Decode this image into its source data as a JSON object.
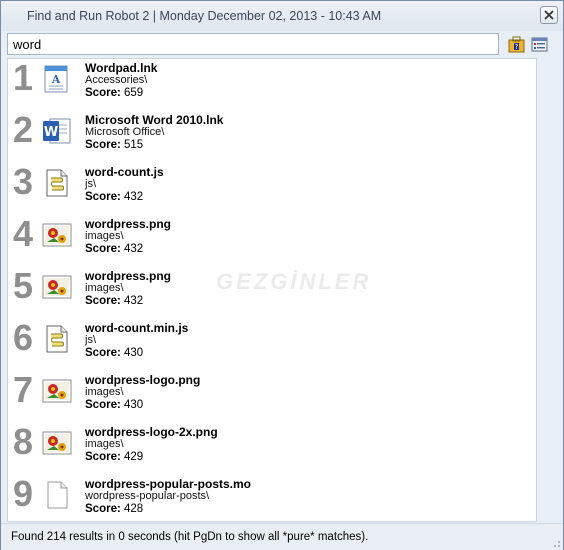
{
  "window": {
    "title": "Find and Run Robot 2 | Monday December 02, 2013  -  10:43 AM"
  },
  "search": {
    "value": "word"
  },
  "score_label": "Score:",
  "watermark": "GEZGİNLER",
  "results": [
    {
      "num": "1",
      "name": "Wordpad.lnk",
      "path": "Accessories\\",
      "score": "659",
      "icon": "wordpad-icon"
    },
    {
      "num": "2",
      "name": "Microsoft Word 2010.lnk",
      "path": "Microsoft Office\\",
      "score": "515",
      "icon": "word-icon"
    },
    {
      "num": "3",
      "name": "word-count.js",
      "path": "js\\",
      "score": "432",
      "icon": "script-icon"
    },
    {
      "num": "4",
      "name": "wordpress.png",
      "path": "images\\",
      "score": "432",
      "icon": "image-icon"
    },
    {
      "num": "5",
      "name": "wordpress.png",
      "path": "images\\",
      "score": "432",
      "icon": "image-icon"
    },
    {
      "num": "6",
      "name": "word-count.min.js",
      "path": "js\\",
      "score": "430",
      "icon": "script-icon"
    },
    {
      "num": "7",
      "name": "wordpress-logo.png",
      "path": "images\\",
      "score": "430",
      "icon": "image-icon"
    },
    {
      "num": "8",
      "name": "wordpress-logo-2x.png",
      "path": "images\\",
      "score": "429",
      "icon": "image-icon"
    },
    {
      "num": "9",
      "name": "wordpress-popular-posts.mo",
      "path": "wordpress-popular-posts\\",
      "score": "428",
      "icon": "file-icon"
    }
  ],
  "status": {
    "text": "Found 214 results in 0 seconds (hit PgDn to show all *pure* matches)."
  }
}
